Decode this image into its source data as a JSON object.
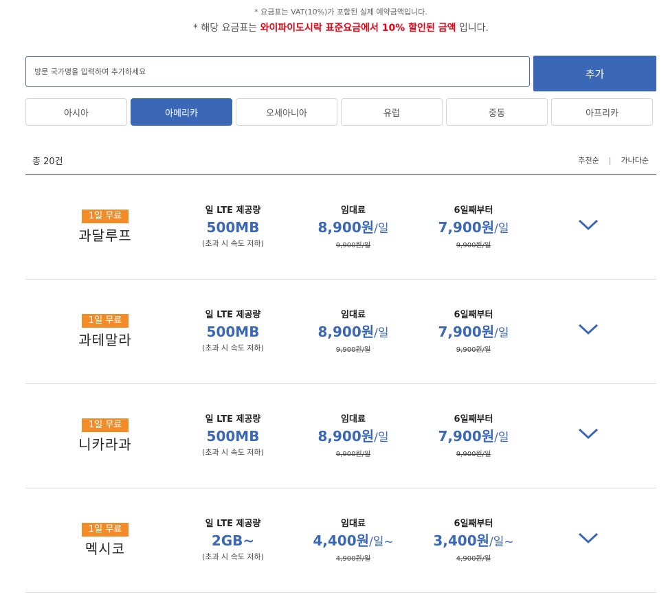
{
  "notes": {
    "line1": "* 요금표는 VAT(10%)가 포함된 실제 예약금액입니다.",
    "line2_prefix": "* 해당 요금표는 ",
    "line2_highlight": "와이파이도시락 표준요금에서 10% 할인된 금액",
    "line2_suffix": " 입니다."
  },
  "search": {
    "placeholder": "방문 국가명을 입력하여 추가하세요",
    "value": "",
    "add_label": "추가"
  },
  "tabs": [
    {
      "label": "아시아",
      "active": false
    },
    {
      "label": "아메리카",
      "active": true
    },
    {
      "label": "오세아니아",
      "active": false
    },
    {
      "label": "유럽",
      "active": false
    },
    {
      "label": "중동",
      "active": false
    },
    {
      "label": "아프리카",
      "active": false
    }
  ],
  "list": {
    "total": "총 20건",
    "sort_recommended": "추천순",
    "sort_separator": "|",
    "sort_alpha": "가나다순"
  },
  "rows": [
    {
      "badge": "1일 무료",
      "country": "과달루프",
      "data_head": "일 LTE 제공량",
      "data_value": "500MB",
      "data_note": "(초과 시 속도 저하)",
      "rent_head": "임대료",
      "rent_price": "8,900원",
      "rent_unit": "/일",
      "rent_orig": "9,900원/일",
      "six_head": "6일째부터",
      "six_price": "7,900원",
      "six_unit": "/일",
      "six_orig": "9,900원/일"
    },
    {
      "badge": "1일 무료",
      "country": "과테말라",
      "data_head": "일 LTE 제공량",
      "data_value": "500MB",
      "data_note": "(초과 시 속도 저하)",
      "rent_head": "임대료",
      "rent_price": "8,900원",
      "rent_unit": "/일",
      "rent_orig": "9,900원/일",
      "six_head": "6일째부터",
      "six_price": "7,900원",
      "six_unit": "/일",
      "six_orig": "9,900원/일"
    },
    {
      "badge": "1일 무료",
      "country": "니카라과",
      "data_head": "일 LTE 제공량",
      "data_value": "500MB",
      "data_note": "(초과 시 속도 저하)",
      "rent_head": "임대료",
      "rent_price": "8,900원",
      "rent_unit": "/일",
      "rent_orig": "9,900원/일",
      "six_head": "6일째부터",
      "six_price": "7,900원",
      "six_unit": "/일",
      "six_orig": "9,900원/일"
    },
    {
      "badge": "1일 무료",
      "country": "멕시코",
      "data_head": "일 LTE 제공량",
      "data_value": "2GB~",
      "data_note": "(초과 시 속도 저하)",
      "rent_head": "임대료",
      "rent_price": "4,400원",
      "rent_unit": "/일~",
      "rent_orig": "4,900원/일",
      "six_head": "6일째부터",
      "six_price": "3,400원",
      "six_unit": "/일~",
      "six_orig": "4,900원/일"
    }
  ],
  "icons": {
    "expand": "chevron-down-icon"
  },
  "colors": {
    "accent": "#3b68b6",
    "badge": "#f28c28",
    "highlight": "#e60012"
  }
}
